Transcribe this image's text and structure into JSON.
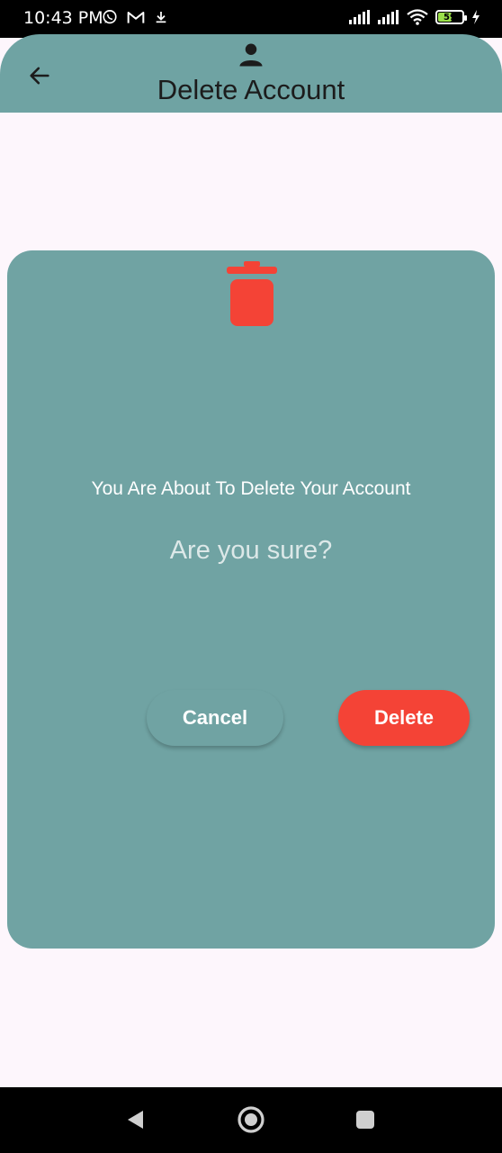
{
  "status_bar": {
    "time": "10:43 PM",
    "left_icons": [
      "whatsapp-icon",
      "gmail-icon",
      "download-icon"
    ],
    "right_icons": [
      "signal-1-icon",
      "signal-2-icon",
      "wifi-icon",
      "battery-icon",
      "charging-icon"
    ],
    "battery_level": "59"
  },
  "app_bar": {
    "title": "Delete Account",
    "back_icon": "arrow-back-icon",
    "account_icon": "person-icon"
  },
  "dialog": {
    "icon": "trash-icon",
    "message": "You Are About To Delete Your Account",
    "question": "Are you sure?",
    "cancel_label": "Cancel",
    "delete_label": "Delete"
  },
  "nav_bar": {
    "icons": [
      "nav-back-icon",
      "nav-home-icon",
      "nav-recents-icon"
    ]
  },
  "colors": {
    "accent": "#6fa3a3",
    "danger": "#f44336",
    "background": "#fdf6fc"
  }
}
